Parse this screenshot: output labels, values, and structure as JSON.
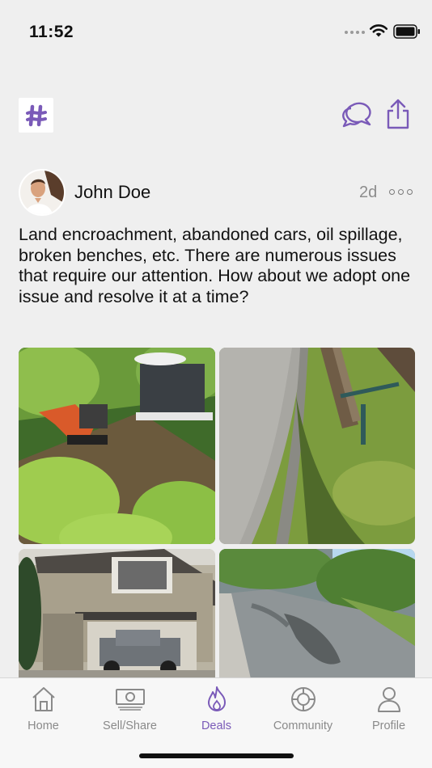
{
  "status_bar": {
    "time": "11:52"
  },
  "header": {
    "logo_icon": "hashtag-logo-icon",
    "actions": [
      "chat-bubbles-icon",
      "share-icon"
    ]
  },
  "post": {
    "author": "John Doe",
    "age": "2d",
    "body": "Land encroachment, abandoned cars, oil spillage, broken benches, etc. There are numerous issues that require our attention. How about we adopt one issue and resolve it at a time?",
    "photos": [
      "excavator-hillside-photo",
      "broken-bench-photo",
      "house-abandoned-truck-photo",
      "oil-spill-road-photo"
    ]
  },
  "tabs": [
    {
      "label": "Home",
      "icon": "home-icon",
      "active": false
    },
    {
      "label": "Sell/Share",
      "icon": "banknote-icon",
      "active": false
    },
    {
      "label": "Deals",
      "icon": "flame-icon",
      "active": true
    },
    {
      "label": "Community",
      "icon": "lifebuoy-icon",
      "active": false
    },
    {
      "label": "Profile",
      "icon": "person-icon",
      "active": false
    }
  ],
  "colors": {
    "accent": "#7a5ab8",
    "background": "#efefef",
    "inactive": "#8a8a8a"
  }
}
